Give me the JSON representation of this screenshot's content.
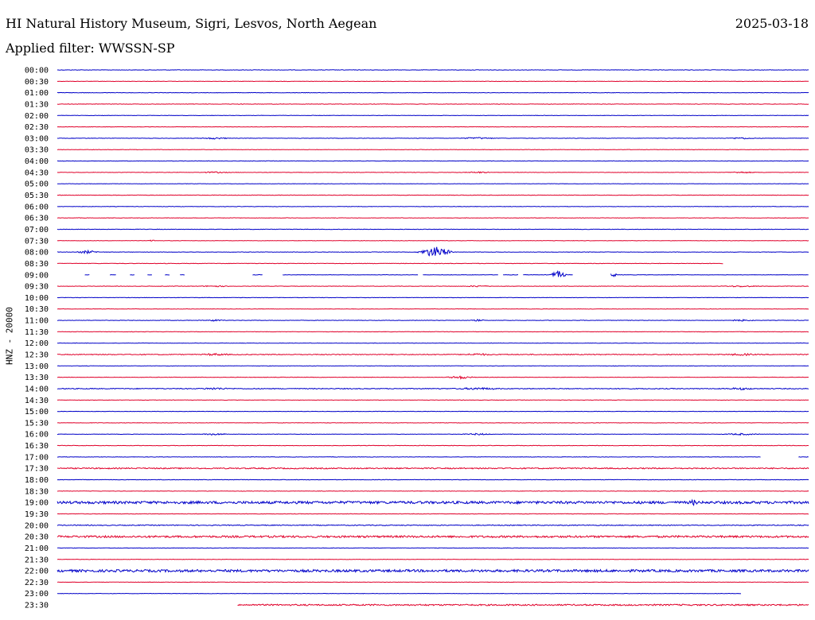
{
  "header": {
    "station": "HI Natural History Museum, Sigri, Lesvos, North Aegean",
    "date": "2025-03-18",
    "filter": "Applied filter: WWSSN-SP"
  },
  "colors": {
    "trace_a": "#0000c8",
    "trace_b": "#e0002a"
  },
  "chart_data": {
    "type": "line",
    "title": "HI Natural History Museum, Sigri, Lesvos, North Aegean",
    "ylabel": "HNZ - 20000",
    "xlabel": "",
    "grid": false,
    "x_unit": "minutes",
    "xlim": [
      0,
      30
    ],
    "rows": [
      {
        "label": "00:00",
        "color": "#0000c8"
      },
      {
        "label": "00:30",
        "color": "#e0002a"
      },
      {
        "label": "01:00",
        "color": "#0000c8"
      },
      {
        "label": "01:30",
        "color": "#e0002a"
      },
      {
        "label": "02:00",
        "color": "#0000c8"
      },
      {
        "label": "02:30",
        "color": "#e0002a"
      },
      {
        "label": "03:00",
        "color": "#0000c8"
      },
      {
        "label": "03:30",
        "color": "#e0002a"
      },
      {
        "label": "04:00",
        "color": "#0000c8"
      },
      {
        "label": "04:30",
        "color": "#e0002a"
      },
      {
        "label": "05:00",
        "color": "#0000c8"
      },
      {
        "label": "05:30",
        "color": "#e0002a"
      },
      {
        "label": "06:00",
        "color": "#0000c8"
      },
      {
        "label": "06:30",
        "color": "#e0002a"
      },
      {
        "label": "07:00",
        "color": "#0000c8"
      },
      {
        "label": "07:30",
        "color": "#e0002a"
      },
      {
        "label": "08:00",
        "color": "#0000c8"
      },
      {
        "label": "08:30",
        "color": "#e0002a"
      },
      {
        "label": "09:00",
        "color": "#0000c8"
      },
      {
        "label": "09:30",
        "color": "#e0002a"
      },
      {
        "label": "10:00",
        "color": "#0000c8"
      },
      {
        "label": "10:30",
        "color": "#e0002a"
      },
      {
        "label": "11:00",
        "color": "#0000c8"
      },
      {
        "label": "11:30",
        "color": "#e0002a"
      },
      {
        "label": "12:00",
        "color": "#0000c8"
      },
      {
        "label": "12:30",
        "color": "#e0002a"
      },
      {
        "label": "13:00",
        "color": "#0000c8"
      },
      {
        "label": "13:30",
        "color": "#e0002a"
      },
      {
        "label": "14:00",
        "color": "#0000c8"
      },
      {
        "label": "14:30",
        "color": "#e0002a"
      },
      {
        "label": "15:00",
        "color": "#0000c8"
      },
      {
        "label": "15:30",
        "color": "#e0002a"
      },
      {
        "label": "16:00",
        "color": "#0000c8"
      },
      {
        "label": "16:30",
        "color": "#e0002a"
      },
      {
        "label": "17:00",
        "color": "#0000c8"
      },
      {
        "label": "17:30",
        "color": "#e0002a"
      },
      {
        "label": "18:00",
        "color": "#0000c8"
      },
      {
        "label": "18:30",
        "color": "#e0002a"
      },
      {
        "label": "19:00",
        "color": "#0000c8"
      },
      {
        "label": "19:30",
        "color": "#e0002a"
      },
      {
        "label": "20:00",
        "color": "#0000c8"
      },
      {
        "label": "20:30",
        "color": "#e0002a"
      },
      {
        "label": "21:00",
        "color": "#0000c8"
      },
      {
        "label": "21:30",
        "color": "#e0002a"
      },
      {
        "label": "22:00",
        "color": "#0000c8"
      },
      {
        "label": "22:30",
        "color": "#e0002a"
      },
      {
        "label": "23:00",
        "color": "#0000c8"
      },
      {
        "label": "23:30",
        "color": "#e0002a"
      }
    ],
    "gaps": [
      {
        "row": "08:30",
        "from": 26.6,
        "to": 30
      },
      {
        "row": "09:00",
        "from": 0,
        "to": 1.1
      },
      {
        "row": "09:00",
        "from": 1.3,
        "to": 2.1
      },
      {
        "row": "09:00",
        "from": 2.35,
        "to": 2.9
      },
      {
        "row": "09:00",
        "from": 3.1,
        "to": 3.6
      },
      {
        "row": "09:00",
        "from": 3.8,
        "to": 4.3
      },
      {
        "row": "09:00",
        "from": 4.5,
        "to": 4.9
      },
      {
        "row": "09:00",
        "from": 5.1,
        "to": 7.8
      },
      {
        "row": "09:00",
        "from": 8.2,
        "to": 9.0
      },
      {
        "row": "09:00",
        "from": 14.4,
        "to": 14.6
      },
      {
        "row": "09:00",
        "from": 17.6,
        "to": 17.8
      },
      {
        "row": "09:00",
        "from": 18.4,
        "to": 18.6
      },
      {
        "row": "09:00",
        "from": 20.6,
        "to": 22.1
      },
      {
        "row": "17:00",
        "from": 28.1,
        "to": 29.6
      },
      {
        "row": "23:00",
        "from": 27.3,
        "to": 30
      },
      {
        "row": "23:30",
        "from": 0,
        "to": 7.2
      }
    ],
    "events": [
      {
        "row": "08:00",
        "t": 15.1,
        "amp": 7,
        "dur": 0.8
      },
      {
        "row": "08:00",
        "t": 1.2,
        "amp": 2,
        "dur": 0.6
      },
      {
        "row": "09:00",
        "t": 20.0,
        "amp": 5,
        "dur": 0.4
      },
      {
        "row": "09:00",
        "t": 22.2,
        "amp": 3,
        "dur": 0.2
      },
      {
        "row": "19:00",
        "t": 25.4,
        "amp": 4,
        "dur": 0.3
      },
      {
        "row": "13:30",
        "t": 16.1,
        "amp": 2,
        "dur": 0.7
      },
      {
        "row": "12:30",
        "t": 6.3,
        "amp": 1.5,
        "dur": 1.0
      },
      {
        "row": "12:30",
        "t": 16.8,
        "amp": 1.5,
        "dur": 1.0
      },
      {
        "row": "12:30",
        "t": 27.3,
        "amp": 1.5,
        "dur": 1.0
      },
      {
        "row": "14:00",
        "t": 6.3,
        "amp": 1.5,
        "dur": 1.0
      },
      {
        "row": "14:00",
        "t": 16.8,
        "amp": 1.5,
        "dur": 1.5
      },
      {
        "row": "14:00",
        "t": 27.3,
        "amp": 1.5,
        "dur": 1.0
      },
      {
        "row": "03:00",
        "t": 6.3,
        "amp": 1.2,
        "dur": 0.8
      },
      {
        "row": "03:00",
        "t": 16.8,
        "amp": 1.2,
        "dur": 1.0
      },
      {
        "row": "03:00",
        "t": 27.3,
        "amp": 1.2,
        "dur": 0.8
      },
      {
        "row": "04:30",
        "t": 6.3,
        "amp": 1,
        "dur": 0.8
      },
      {
        "row": "04:30",
        "t": 16.8,
        "amp": 1,
        "dur": 0.8
      },
      {
        "row": "04:30",
        "t": 27.3,
        "amp": 1,
        "dur": 1.0
      },
      {
        "row": "09:30",
        "t": 6.3,
        "amp": 1,
        "dur": 0.8
      },
      {
        "row": "09:30",
        "t": 16.8,
        "amp": 1,
        "dur": 0.8
      },
      {
        "row": "09:30",
        "t": 27.3,
        "amp": 1,
        "dur": 1.2
      },
      {
        "row": "11:00",
        "t": 6.3,
        "amp": 1.2,
        "dur": 0.6
      },
      {
        "row": "11:00",
        "t": 16.8,
        "amp": 1.2,
        "dur": 0.4
      },
      {
        "row": "11:00",
        "t": 27.3,
        "amp": 1.2,
        "dur": 0.8
      },
      {
        "row": "16:00",
        "t": 6.3,
        "amp": 1.2,
        "dur": 0.8
      },
      {
        "row": "16:00",
        "t": 16.8,
        "amp": 1.2,
        "dur": 0.8
      },
      {
        "row": "16:00",
        "t": 27.3,
        "amp": 1.2,
        "dur": 1.0
      },
      {
        "row": "07:30",
        "t": 3.8,
        "amp": 1,
        "dur": 0.3
      }
    ],
    "noise": [
      {
        "row": "19:00",
        "amp": 1.6
      },
      {
        "row": "20:30",
        "amp": 1.2
      },
      {
        "row": "22:00",
        "amp": 1.5
      },
      {
        "row": "23:30",
        "amp": 0.9
      },
      {
        "row": "17:30",
        "amp": 0.7
      },
      {
        "row": "12:30",
        "amp": 0.5
      },
      {
        "row": "14:00",
        "amp": 0.5
      },
      {
        "row": "20:00",
        "amp": 0.5
      }
    ]
  }
}
